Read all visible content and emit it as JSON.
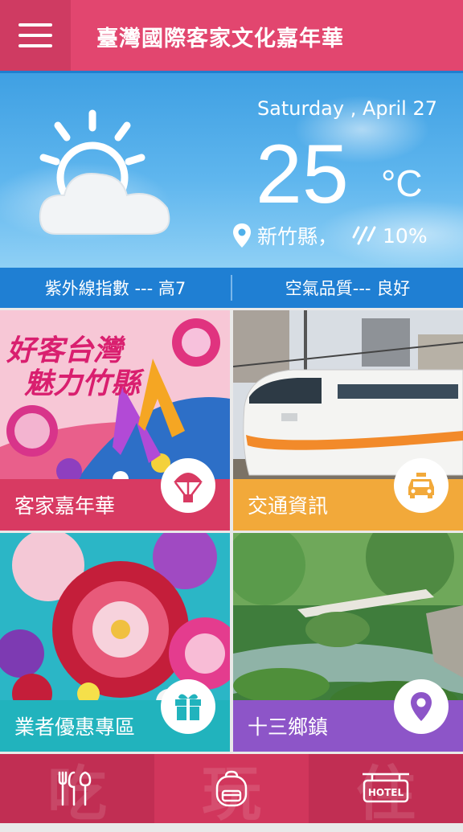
{
  "header": {
    "title": "臺灣國際客家文化嘉年華",
    "menu_icon": "hamburger-menu-icon"
  },
  "weather": {
    "date": "Saturday , April 27",
    "temperature": "25",
    "unit": "°C",
    "location": "新竹縣，",
    "rain_chance": "10%",
    "condition_icon": "partly-cloudy-icon",
    "uv_index": "紫外線指數 --- 高7",
    "air_quality": "空氣品質--- 良好"
  },
  "tiles": [
    {
      "label": "客家嘉年華",
      "icon": "parachute-icon",
      "color": "#d83a62",
      "banner_text_line1": "好客台灣",
      "banner_text_line2": "魅力竹縣"
    },
    {
      "label": "交通資訊",
      "icon": "taxi-icon",
      "color": "#f2a93a"
    },
    {
      "label": "業者優惠專區",
      "icon": "gift-icon",
      "color": "#21b3bd"
    },
    {
      "label": "十三鄉鎮",
      "icon": "location-pin-icon",
      "color": "#8d55c8"
    }
  ],
  "bottom_nav": [
    {
      "ghost": "吃",
      "icon": "utensils-icon"
    },
    {
      "ghost": "玩",
      "icon": "backpack-icon"
    },
    {
      "ghost": "住",
      "icon": "hotel-sign-icon",
      "sign_text": "HOTEL"
    }
  ]
}
